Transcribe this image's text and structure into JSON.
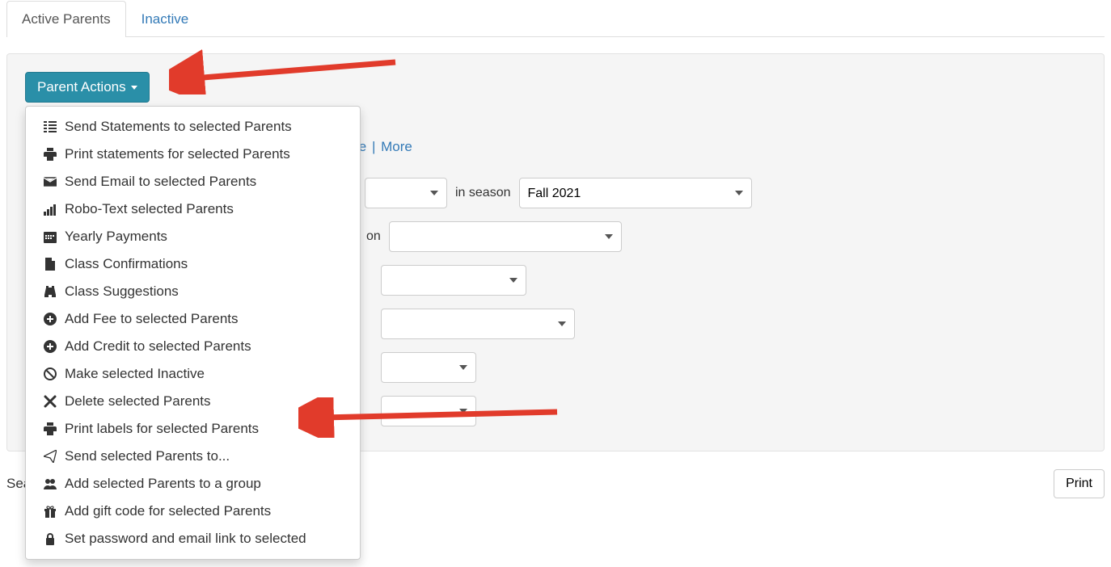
{
  "tabs": {
    "active": "Active Parents",
    "inactive": "Inactive"
  },
  "parent_actions_button": "Parent Actions",
  "dropdown_items": {
    "send_statements": "Send Statements to selected Parents",
    "print_statements": "Print statements for selected Parents",
    "send_email": "Send Email to selected Parents",
    "robo_text": "Robo-Text selected Parents",
    "yearly_payments": "Yearly Payments",
    "class_confirmations": "Class Confirmations",
    "class_suggestions": "Class Suggestions",
    "add_fee": "Add Fee to selected Parents",
    "add_credit": "Add Credit to selected Parents",
    "make_inactive": "Make selected Inactive",
    "delete": "Delete selected Parents",
    "print_labels": "Print labels for selected Parents",
    "send_to": "Send selected Parents to...",
    "add_group": "Add selected Parents to a group",
    "add_gift_code": "Add gift code for selected Parents",
    "set_password": "Set password and email link to selected"
  },
  "filter_links": {
    "visible_peek": "e",
    "more": "More"
  },
  "filters": {
    "in_season_label": "in season",
    "season_value": "Fall 2021",
    "on_label": "on"
  },
  "bottom": {
    "search_prefix": "Sea",
    "print_button": "Print"
  }
}
